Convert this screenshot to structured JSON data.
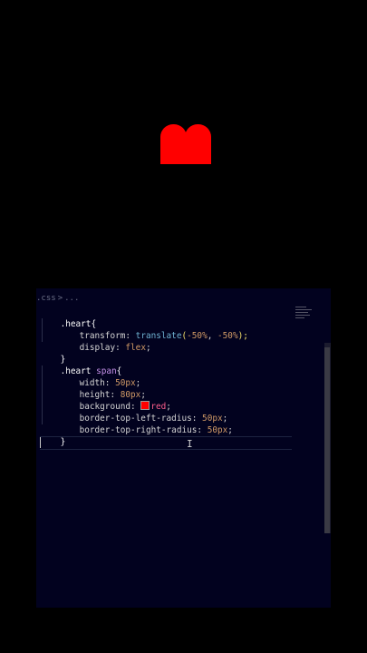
{
  "preview": {
    "shape_color": "#ff0000",
    "background": "#000000"
  },
  "editor": {
    "breadcrumb": {
      "file": ".css",
      "separator": ">",
      "rest": "..."
    },
    "lines": [
      {
        "t1": ".heart{"
      },
      {
        "t1": "transform: ",
        "t2": "translate",
        "t3": "(",
        "t4": "-50%",
        "t5": ", ",
        "t6": "-50%",
        "t7": ");"
      },
      {
        "t1": "display: ",
        "t2": "flex",
        "t3": ";"
      },
      {
        "t1": "}"
      },
      {
        "t1": ".heart ",
        "t2": "span",
        "t3": "{"
      },
      {
        "t1": "width: ",
        "t2": "50px",
        "t3": ";"
      },
      {
        "t1": "height: ",
        "t2": "80px",
        "t3": ";"
      },
      {
        "t1": "background: ",
        "t2": "red",
        "t3": ";"
      },
      {
        "t1": "border-top-left-radius: ",
        "t2": "50px",
        "t3": ";"
      },
      {
        "t1": "border-top-right-radius: ",
        "t2": "50px",
        "t3": ";"
      },
      {
        "t1": "}"
      }
    ],
    "colors": {
      "editor_bg": "#02021f",
      "selector": "#ffffff",
      "function": "#6fb3d2",
      "number": "#d19a66",
      "keyword": "#c792ea",
      "swatch": "#ff0000"
    },
    "cursor_icon": "text-cursor-icon"
  }
}
